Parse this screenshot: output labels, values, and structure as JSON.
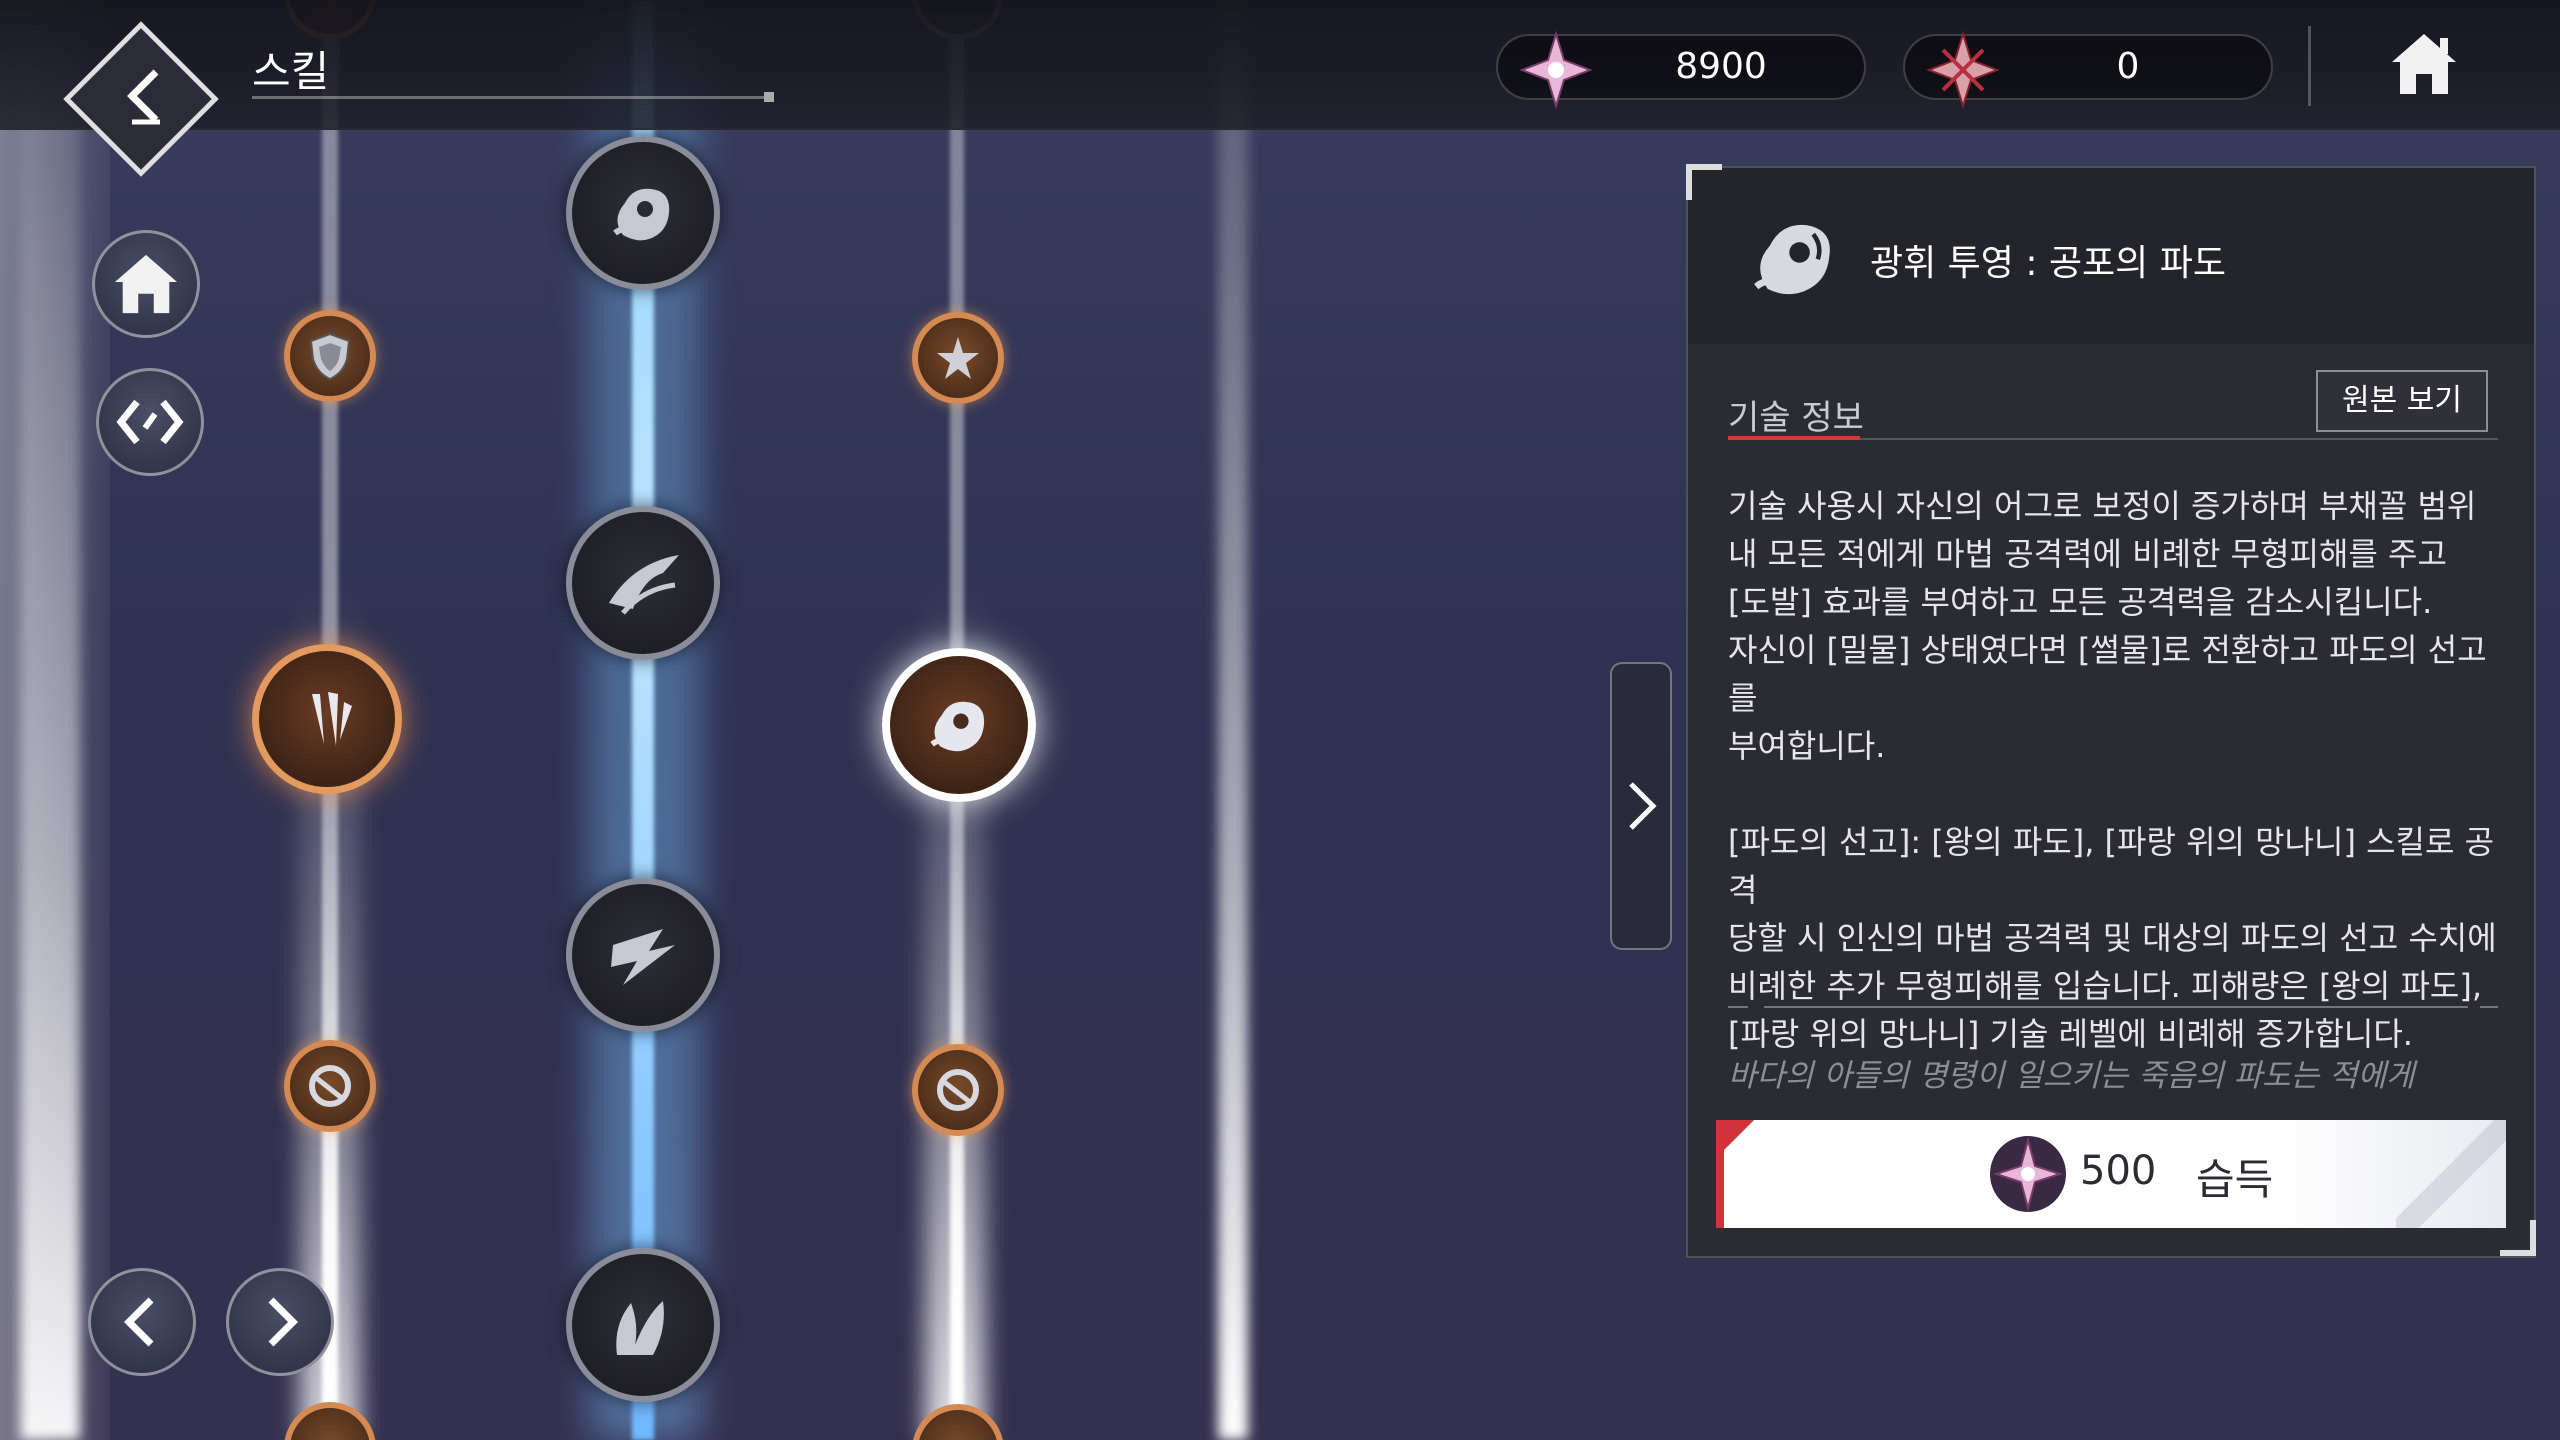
{
  "header": {
    "title": "스킬",
    "currency_1": {
      "icon": "pink-star-crest-icon",
      "value": "8900"
    },
    "currency_2": {
      "icon": "red-star-crest-icon",
      "value": "0"
    },
    "home_icon": "home-icon"
  },
  "sidebar": {
    "home_icon": "home-icon",
    "swap_icon": "swap-arrows-icon",
    "prev_icon": "chevron-left-icon",
    "next_icon": "chevron-right-icon"
  },
  "panel": {
    "skill_name": "광휘 투영 : 공포의 파도",
    "tab_label": "기술 정보",
    "original_view_label": "원본 보기",
    "description": "기술 사용시 자신의 어그로 보정이 증가하며 부채꼴 범위\n내 모든 적에게 마법 공격력에 비례한 무형피해를 주고\n[도발] 효과를 부여하고 모든 공격력을 감소시킵니다.\n자신이 [밀물] 상태였다면 [썰물]로 전환하고 파도의 선고를\n부여합니다.\n\n[파도의 선고]: [왕의 파도], [파랑 위의 망나니] 스킬로 공격\n당할 시 인신의 마법 공격력 및 대상의 파도의 선고 수치에\n비례한 추가 무형피해를 입습니다. 피해량은 [왕의 파도],\n[파랑 위의 망나니] 기술 레벨에 비례해 증가합니다.",
    "flavor_text": "바다의 아들의 명령이 일으키는 죽음의 파도는 적에게",
    "acquire": {
      "cost": "500",
      "label": "습득"
    }
  },
  "colors": {
    "accent_red": "#d2323a",
    "node_bronze": "#d48a52",
    "beam_blue": "#8fd0ff"
  }
}
